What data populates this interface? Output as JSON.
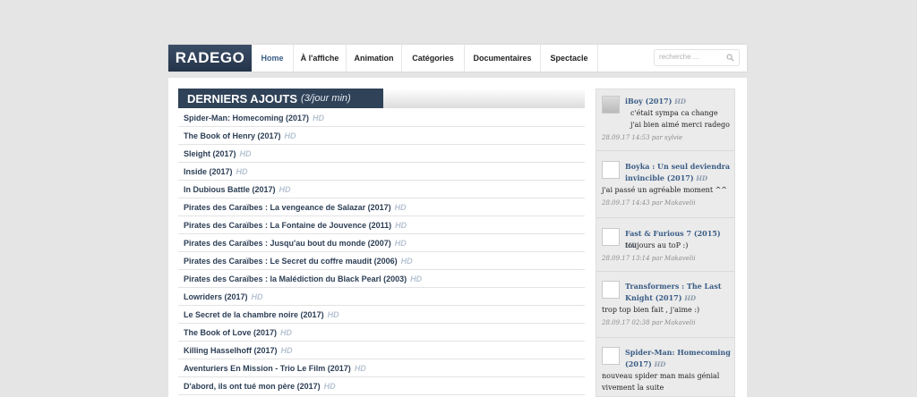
{
  "header": {
    "logo": "RADEGO",
    "nav": [
      {
        "label": "Home",
        "active": true
      },
      {
        "label": "À l'affiche",
        "active": false
      },
      {
        "label": "Animation",
        "active": false
      },
      {
        "label": "Catégories",
        "active": false
      },
      {
        "label": "Documentaires",
        "active": false
      },
      {
        "label": "Spectacle",
        "active": false
      }
    ],
    "search": {
      "placeholder": "recherche ..."
    }
  },
  "main": {
    "section_title": "DERNIERS AJOUTS",
    "section_subtitle": "(3/jour min)",
    "hd_label": "HD",
    "movies": [
      "Spider-Man: Homecoming (2017)",
      "The Book of Henry (2017)",
      "Sleight (2017)",
      "Inside (2017)",
      "In Dubious Battle (2017)",
      "Pirates des Caraïbes : La vengeance de Salazar (2017)",
      "Pirates des Caraïbes : La Fontaine de Jouvence (2011)",
      "Pirates des Caraïbes : Jusqu'au bout du monde (2007)",
      "Pirates des Caraïbes : Le Secret du coffre maudit (2006)",
      "Pirates des Caraïbes : la Malédiction du Black Pearl (2003)",
      "Lowriders (2017)",
      "Le Secret de la chambre noire (2017)",
      "The Book of Love (2017)",
      "Killing Hasselhoff (2017)",
      "Aventuriers En Mission - Trio Le Film (2017)",
      "D'abord, ils ont tué mon père (2017)"
    ]
  },
  "sidebar": {
    "comments": [
      {
        "title": "iBoy (2017)",
        "hd": "HD",
        "text": "c'était sympa ca change j'ai bien aimé merci radego",
        "meta": "28.09.17 14:53 par sylvie"
      },
      {
        "title": "Boyka : Un seul deviendra invincible (2017)",
        "hd": "HD",
        "text": "j'ai passé un agréable moment ^^",
        "meta": "28.09.17 14:43 par Makavelii"
      },
      {
        "title": "Fast & Furious 7 (2015)",
        "hd": "HD",
        "text": "toujours au toP :)",
        "meta": "28.09.17 13:14 par Makavelii"
      },
      {
        "title": "Transformers : The Last Knight (2017)",
        "hd": "HD",
        "text": "trop top bien fait , j'aime :)",
        "meta": "28.09.17 02:38 par Makavelii"
      },
      {
        "title": "Spider-Man: Homecoming (2017)",
        "hd": "HD",
        "text": "nouveau spider man mais génial vivement la suite",
        "meta": ""
      }
    ]
  }
}
